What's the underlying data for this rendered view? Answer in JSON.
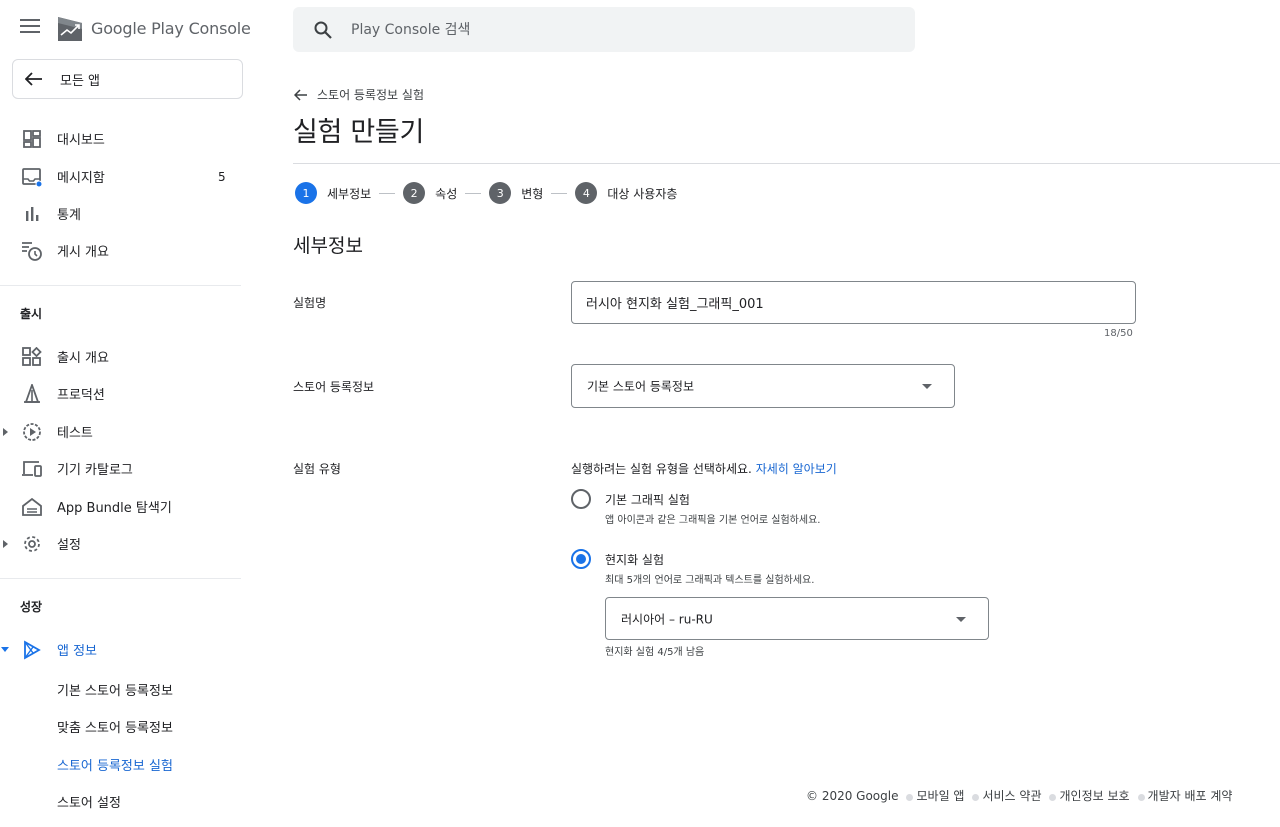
{
  "app": {
    "logo_google": "Google Play",
    "logo_console": "Console"
  },
  "search": {
    "placeholder": "Play Console 검색"
  },
  "sidebar": {
    "all_apps": "모든 앱",
    "top_items": [
      {
        "label": "대시보드"
      },
      {
        "label": "메시지함",
        "badge": "5"
      },
      {
        "label": "통계"
      },
      {
        "label": "게시 개요"
      }
    ],
    "section_release": "출시",
    "release_items": [
      {
        "label": "출시 개요"
      },
      {
        "label": "프로덕션"
      },
      {
        "label": "테스트"
      },
      {
        "label": "기기 카탈로그"
      },
      {
        "label": "App Bundle 탐색기"
      },
      {
        "label": "설정"
      }
    ],
    "section_growth": "성장",
    "growth_item": "앱 정보",
    "growth_sub_items": [
      {
        "label": "기본 스토어 등록정보"
      },
      {
        "label": "맞춤 스토어 등록정보"
      },
      {
        "label": "스토어 등록정보 실험"
      },
      {
        "label": "스토어 설정"
      }
    ]
  },
  "main": {
    "back_label": "스토어 등록정보 실험",
    "title": "실험 만들기",
    "steps": [
      {
        "num": "1",
        "label": "세부정보"
      },
      {
        "num": "2",
        "label": "속성"
      },
      {
        "num": "3",
        "label": "변형"
      },
      {
        "num": "4",
        "label": "대상 사용자층"
      }
    ],
    "section_heading": "세부정보",
    "fields": {
      "name_label": "실험명",
      "name_value": "러시아 현지화 실험_그래픽_001",
      "name_counter": "18/50",
      "listing_label": "스토어 등록정보",
      "listing_value": "기본 스토어 등록정보",
      "type_label": "실험 유형",
      "type_helper": "실행하려는 실험 유형을 선택하세요.",
      "type_learn_more": "자세히 알아보기",
      "option_default_title": "기본 그래픽 실험",
      "option_default_desc": "앱 아이콘과 같은 그래픽을 기본 언어로 실험하세요.",
      "option_local_title": "현지화 실험",
      "option_local_desc": "최대 5개의 언어로 그래픽과 텍스트를 실험하세요.",
      "language_value": "러시아어 – ru-RU",
      "remaining": "현지화 실험 4/5개 남음"
    }
  },
  "footer": {
    "copyright": "© 2020 Google",
    "links": [
      "모바일 앱",
      "서비스 약관",
      "개인정보 보호",
      "개발자 배포 계약"
    ]
  },
  "colors": {
    "accent": "#1a73e8",
    "link": "#1967d2",
    "icon": "#5f6368"
  }
}
